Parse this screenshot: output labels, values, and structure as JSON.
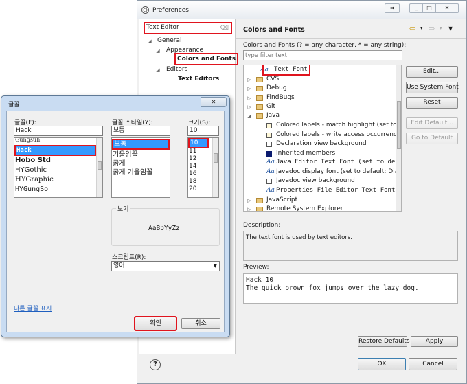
{
  "preferences": {
    "title": "Preferences",
    "filter_value": "Text Editor",
    "tree": {
      "general": "General",
      "appearance": "Appearance",
      "colors_and_fonts": "Colors and Fonts",
      "editors": "Editors",
      "text_editors": "Text Editors"
    },
    "page_title": "Colors and Fonts",
    "filter_label": "Colors and Fonts (? = any character, * = any string):",
    "filter_placeholder": "type filter text",
    "items": {
      "text_font": "Text Font",
      "cvs": "CVS",
      "debug": "Debug",
      "findbugs": "FindBugs",
      "git": "Git",
      "java": "Java",
      "colored_labels_match": "Colored labels - match highlight (set to de",
      "colored_labels_write": "Colored labels - write access occurrences",
      "declaration_view_bg": "Declaration view background",
      "inherited_members": "Inherited members",
      "java_editor_text_font": "Java Editor Text Font (set to de",
      "javadoc_display_font": "Javadoc display font (set to default: Dialog",
      "javadoc_view_bg": "Javadoc view background",
      "properties_editor_font": "Properties File Editor Text Font",
      "javascript": "JavaScript",
      "remote_system_explorer": "Remote System Explorer"
    },
    "buttons": {
      "edit": "Edit...",
      "use_system_font": "Use System Font",
      "reset": "Reset",
      "edit_default": "Edit Default...",
      "go_to_default": "Go to Default",
      "restore_defaults": "Restore Defaults",
      "apply": "Apply",
      "ok": "OK",
      "cancel": "Cancel"
    },
    "description_label": "Description:",
    "description_text": "The text font is used by text editors.",
    "preview_label": "Preview:",
    "preview_line1": "Hack 10",
    "preview_line2": "The quick brown fox jumps over the lazy dog.",
    "help_glyph": "?"
  },
  "font_dialog": {
    "title": "글꼴",
    "font_label": "글꼴(F):",
    "font_value": "Hack",
    "fonts": [
      "Gungsuh",
      "Hack",
      "Hobo Std",
      "HYGothic",
      "HYGraphic",
      "HYGungSo"
    ],
    "style_label": "글꼴 스타일(Y):",
    "style_value": "보통",
    "styles": [
      "보통",
      "기울임꼴",
      "굵게",
      "굵게 기울임꼴"
    ],
    "size_label": "크기(S):",
    "size_value": "10",
    "sizes": [
      "10",
      "11",
      "12",
      "14",
      "16",
      "18",
      "20"
    ],
    "preview_group": "보기",
    "sample": "AaBbYyZz",
    "script_label": "스크립트(R):",
    "script_value": "영어",
    "more_fonts": "다른 글꼴 표시",
    "ok": "확인",
    "cancel": "취소",
    "close_glyph": "✕"
  },
  "colors": {
    "highlight": "#e0141e",
    "selection": "#3399ff",
    "java_font_icon": "#1b4f9c",
    "inherited_members_swatch": "#0a1a6e"
  }
}
